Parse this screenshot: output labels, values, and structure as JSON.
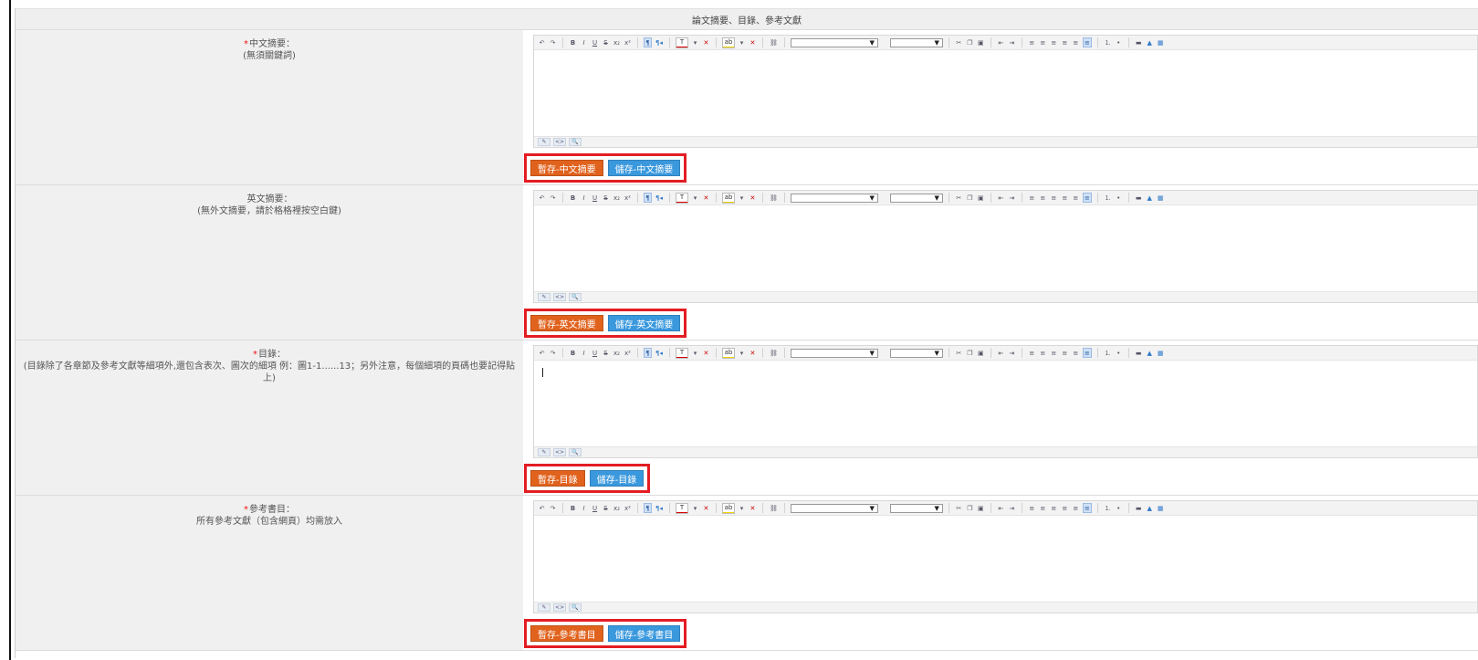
{
  "section_title": "論文摘要、目錄、參考文獻",
  "colors": {
    "temp_button": "#e0621d",
    "save_button": "#3a98dd",
    "highlight_box": "#e31d23",
    "required_mark": "#e11111"
  },
  "toolbar": {
    "font_family_select": "",
    "font_size_select": ""
  },
  "fields": [
    {
      "required": "*",
      "label": "中文摘要：",
      "note": "(無須關鍵詞)",
      "value": "",
      "temp_button": "暫存-中文摘要",
      "save_button": "儲存-中文摘要"
    },
    {
      "required": "",
      "label": "英文摘要：",
      "note": "(無外文摘要，請於格格裡按空白鍵)",
      "value": "",
      "temp_button": "暫存-英文摘要",
      "save_button": "儲存-英文摘要"
    },
    {
      "required": "*",
      "label": "目錄：",
      "note": "(目錄除了各章節及參考文獻等細項外,還包含表次、圖次的細項 例：圖1-1......13；另外注意，每個細項的頁碼也要記得貼上)",
      "value": "",
      "temp_button": "暫存-目錄",
      "save_button": "儲存-目錄"
    },
    {
      "required": "*",
      "label": "參考書目：",
      "note": "所有參考文獻（包含網頁）均需放入",
      "value": "",
      "temp_button": "暫存-參考書目",
      "save_button": "儲存-參考書目"
    }
  ]
}
